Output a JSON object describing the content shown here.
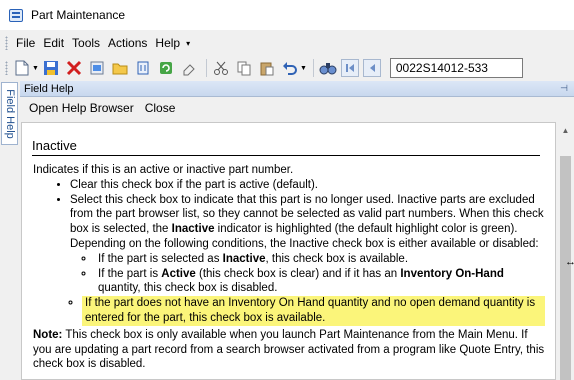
{
  "window": {
    "title": "Part Maintenance"
  },
  "menu": {
    "items": [
      "File",
      "Edit",
      "Tools",
      "Actions",
      "Help"
    ],
    "overflow_arrow": "▾"
  },
  "toolbar": {
    "record_value": "0022S14012-533",
    "icons": [
      "new-icon",
      "save-icon",
      "delete-icon",
      "refresh-icon",
      "open-icon",
      "attach-icon",
      "recycle-icon",
      "eraser-icon",
      "cut-icon",
      "copy-icon",
      "paste-icon",
      "undo-icon",
      "search-icon",
      "first-record-icon",
      "previous-record-icon"
    ]
  },
  "side_tab": {
    "label": "Field Help"
  },
  "panel": {
    "title": "Field Help",
    "menu": {
      "open_help_browser": "Open Help Browser",
      "close": "Close"
    }
  },
  "help": {
    "heading": "Inactive",
    "intro": "Indicates if this is an active or inactive part number.",
    "b1": "Clear this check box if the part is active (default).",
    "b2_a": "Select this check box to indicate that this part is no longer used. Inactive parts are excluded from the part browser list, so they cannot be selected as valid part numbers. When this check box is selected, the ",
    "b2_bold": "Inactive",
    "b2_b": " indicator is highlighted (the default highlight color is green). Depending on the following conditions, the Inactive check box is either available or disabled:",
    "s1_a": "If the part is selected as ",
    "s1_bold": "Inactive",
    "s1_b": ", this check box is available.",
    "s2_a": "If the part is ",
    "s2_bold1": "Active",
    "s2_b": " (this check box is clear) and if it has an ",
    "s2_bold2": "Inventory On-Hand",
    "s2_c": " quantity, this check box is disabled.",
    "s3": "If the part does not have an Inventory On Hand quantity and no open demand quantity is entered for the part, this check box is available.",
    "note_label": "Note:",
    "note": " This check box is only available when you launch Part Maintenance from the Main Menu. If you are updating a part record from a search browser activated from a program like Quote Entry, this check box is disabled."
  },
  "colors": {
    "highlight": "#fbf57a",
    "panel_header": "#c8d8ee",
    "accent_blue": "#2a62b8"
  }
}
